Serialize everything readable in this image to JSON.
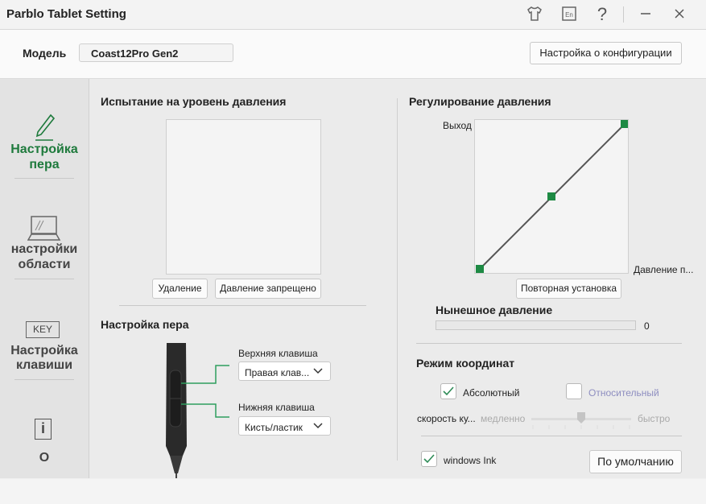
{
  "window": {
    "title": "Parblo Tablet Setting"
  },
  "titlebar_icons": [
    "shirt-icon",
    "language-icon",
    "help-icon",
    "minimize-icon",
    "close-icon"
  ],
  "model": {
    "label": "Модель",
    "value": "Coast12Pro Gen2",
    "config_button": "Настройка о конфигурации"
  },
  "sidebar": {
    "items": [
      {
        "label_line1": "Настройка",
        "label_line2": "пера",
        "icon": "pen-icon",
        "active": true
      },
      {
        "label_line1": "настройки",
        "label_line2": "области",
        "icon": "laptop-icon",
        "active": false
      },
      {
        "label_line1": "Настройка",
        "label_line2": "клавиши",
        "icon": "key-icon",
        "icon_text": "KEY",
        "active": false
      },
      {
        "label_line1": "O",
        "icon": "info-icon",
        "icon_text": "i",
        "active": false
      }
    ]
  },
  "pressure_test": {
    "title": "Испытание на уровень давления",
    "delete_button": "Удаление",
    "disable_button": "Давление запрещено"
  },
  "pen_settings": {
    "title": "Настройка пера",
    "upper_key_label": "Верхняя клавиша",
    "upper_key_value": "Правая клав...",
    "lower_key_label": "Нижняя клавиша",
    "lower_key_value": "Кисть/ластик"
  },
  "pressure_adjust": {
    "title": "Регулирование давления",
    "y_label": "Выход",
    "x_label": "Давление п...",
    "reset_button": "Повторная установка",
    "current_label": "Нынешное давление",
    "current_value": "0",
    "current_fraction": 0
  },
  "coord_mode": {
    "title": "Режим координат",
    "absolute_label": "Абсолютный",
    "absolute_checked": true,
    "relative_label": "Относительный",
    "relative_checked": false,
    "speed_label": "скорость ку...",
    "slow_label": "медленно",
    "fast_label": "быстро",
    "speed_fraction": 0.5
  },
  "windows_ink": {
    "label": "windows Ink",
    "checked": true
  },
  "default_button": "По умолчанию",
  "colors": {
    "accent": "#1e7a3c",
    "curve_point": "#1e8a44",
    "relative_text": "#8e8ec0"
  }
}
